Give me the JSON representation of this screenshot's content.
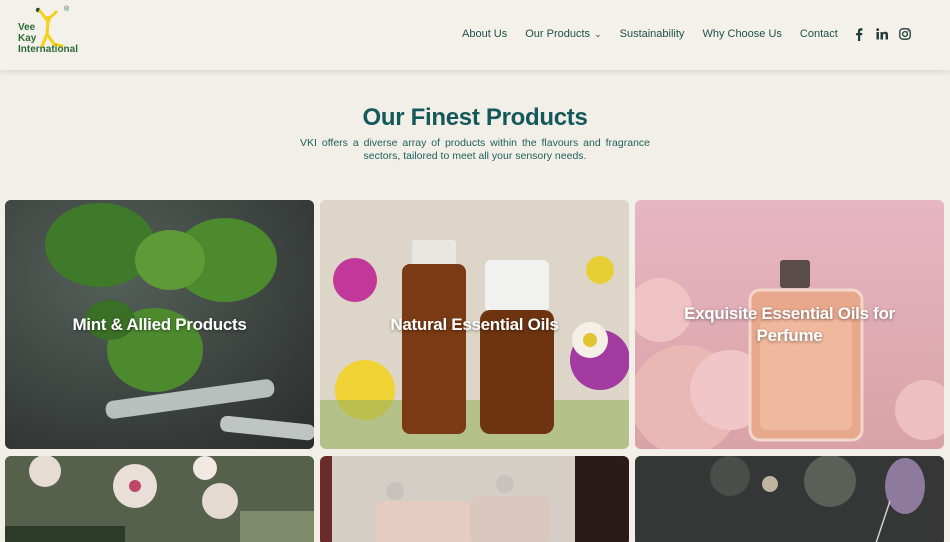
{
  "header": {
    "logo": {
      "lines": [
        "Vee",
        "Kay",
        "International"
      ],
      "reg_mark": "®"
    },
    "nav": [
      {
        "label": "About Us"
      },
      {
        "label": "Our Products",
        "has_dropdown": true,
        "chevron": "chevron-down-icon"
      },
      {
        "label": "Sustainability"
      },
      {
        "label": "Why Choose Us"
      },
      {
        "label": "Contact"
      }
    ],
    "socials": [
      "facebook-icon",
      "linkedin-icon",
      "instagram-icon"
    ]
  },
  "intro": {
    "title": "Our Finest Products",
    "subtitle": "VKI offers a diverse array of products within the flavours and fragrance sectors, tailored to meet all your sensory needs."
  },
  "products": [
    {
      "label": "Mint & Allied Products"
    },
    {
      "label": "Natural Essential Oils"
    },
    {
      "label": "Exquisite Essential Oils for Perfume"
    },
    {
      "label": ""
    },
    {
      "label": ""
    },
    {
      "label": ""
    }
  ],
  "colors": {
    "background": "#f2efe8",
    "brand_teal": "#15585a",
    "logo_green": "#2d6a3a",
    "logo_yellow": "#f2d21c"
  }
}
